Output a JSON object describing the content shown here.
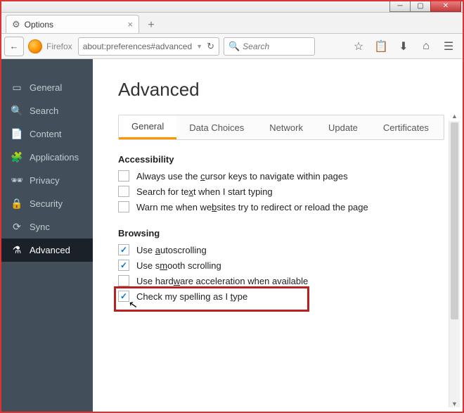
{
  "window": {
    "tab_title": "Options",
    "firefox_label": "Firefox",
    "url": "about:preferences#advanced",
    "search_placeholder": "Search"
  },
  "sidebar": {
    "items": [
      {
        "icon": "▭",
        "label": "General"
      },
      {
        "icon": "🔍",
        "label": "Search"
      },
      {
        "icon": "📄",
        "label": "Content"
      },
      {
        "icon": "🧩",
        "label": "Applications"
      },
      {
        "icon": "🕶",
        "label": "Privacy"
      },
      {
        "icon": "🔒",
        "label": "Security"
      },
      {
        "icon": "⟳",
        "label": "Sync"
      },
      {
        "icon": "⚗",
        "label": "Advanced"
      }
    ]
  },
  "page": {
    "title": "Advanced",
    "tabs": [
      "General",
      "Data Choices",
      "Network",
      "Update",
      "Certificates"
    ],
    "accessibility": {
      "title": "Accessibility",
      "opts": [
        {
          "checked": false,
          "pre": "Always use the ",
          "u": "c",
          "post": "ursor keys to navigate within pages"
        },
        {
          "checked": false,
          "pre": "Search for te",
          "u": "x",
          "post": "t when I start typing"
        },
        {
          "checked": false,
          "pre": "Warn me when we",
          "u": "b",
          "post": "sites try to redirect or reload the page"
        }
      ]
    },
    "browsing": {
      "title": "Browsing",
      "opts": [
        {
          "checked": true,
          "pre": "Use ",
          "u": "a",
          "post": "utoscrolling"
        },
        {
          "checked": true,
          "pre": "Use s",
          "u": "m",
          "post": "ooth scrolling"
        },
        {
          "checked": false,
          "pre": "Use hard",
          "u": "w",
          "post": "are acceleration when available"
        },
        {
          "checked": true,
          "pre": "Check my spelling as I ",
          "u": "t",
          "post": "ype"
        }
      ]
    }
  }
}
